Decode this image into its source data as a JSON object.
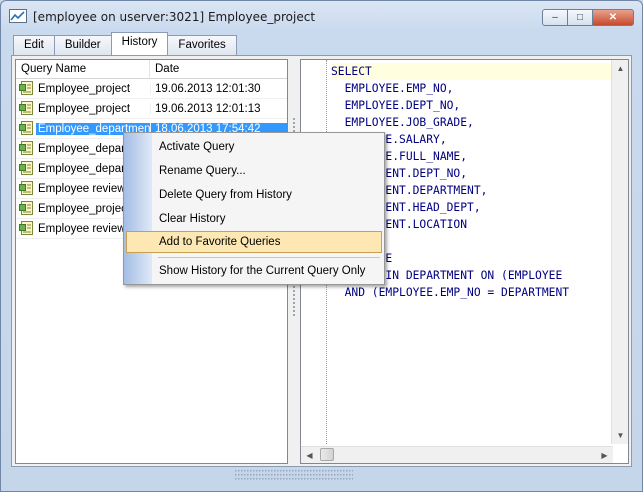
{
  "window": {
    "title": "[employee on userver:3021] Employee_project",
    "minimize": "–",
    "maximize": "□",
    "close": "✕"
  },
  "tabs": [
    {
      "label": "Edit"
    },
    {
      "label": "Builder"
    },
    {
      "label": "History",
      "active": true
    },
    {
      "label": "Favorites"
    }
  ],
  "history": {
    "columns": {
      "name": "Query Name",
      "date": "Date"
    },
    "rows": [
      {
        "name": "Employee_project",
        "date": "19.06.2013 12:01:30"
      },
      {
        "name": "Employee_project",
        "date": "19.06.2013 12:01:13"
      },
      {
        "name": "Employee_department",
        "date": "18.06.2013 17:54:42",
        "selected": true
      },
      {
        "name": "Employee_departm",
        "date": ""
      },
      {
        "name": "Employee_departm",
        "date": ""
      },
      {
        "name": "Employee review",
        "date": ""
      },
      {
        "name": "Employee_project",
        "date": ""
      },
      {
        "name": "Employee review",
        "date": ""
      }
    ]
  },
  "editor": {
    "lines": [
      "SELECT",
      "  EMPLOYEE.EMP_NO,",
      "  EMPLOYEE.DEPT_NO,",
      "  EMPLOYEE.JOB_GRADE,",
      "      YEE.SALARY,",
      "      YEE.FULL_NAME,",
      "      TMENT.DEPT_NO,",
      "      TMENT.DEPARTMENT,",
      "      TMENT.HEAD_DEPT,",
      "      TMENT.LOCATION",
      "",
      "      YEE",
      "      JOIN DEPARTMENT ON (EMPLOYEE",
      "  AND (EMPLOYEE.EMP_NO = DEPARTMENT"
    ]
  },
  "context_menu": {
    "items": [
      {
        "label": "Activate Query"
      },
      {
        "label": "Rename Query..."
      },
      {
        "label": "Delete Query from History"
      },
      {
        "label": "Clear History"
      },
      {
        "label": "Add to Favorite Queries",
        "highlighted": true
      },
      {
        "label": "Show History for the Current Query Only"
      }
    ]
  },
  "icons": {
    "app": "query-editor-icon",
    "row": "query-history-icon"
  },
  "colors": {
    "selection": "#3399ff",
    "menu_highlight": "#fde8b4",
    "sql_text": "#000080"
  }
}
